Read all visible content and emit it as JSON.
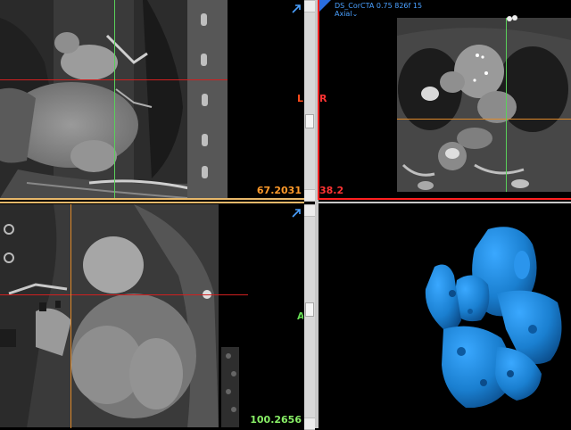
{
  "viewports": {
    "coronal": {
      "slice_value": "67.2031",
      "right_label": "L",
      "accent": "#ff9a2a"
    },
    "axial": {
      "slice_value": "38.2",
      "left_label": "R",
      "series_description": "DS_CorCTA  0.75  826f  15",
      "view_selector": "Axial",
      "accent": "#ff3333"
    },
    "sagittal": {
      "slice_value": "100.2656",
      "right_label": "A",
      "accent": "#88ee66"
    },
    "volume_3d": {}
  },
  "icons": {
    "maximize": "maximize-arrow-icon",
    "dropdown": "chevron-down-icon",
    "orientation_marker": "corner-triangle-icon"
  },
  "colors": {
    "crosshair_red": "#d02020",
    "crosshair_green": "#5ad05a",
    "crosshair_orange": "#e08a2a",
    "volume_render": "#1a7fd0"
  }
}
